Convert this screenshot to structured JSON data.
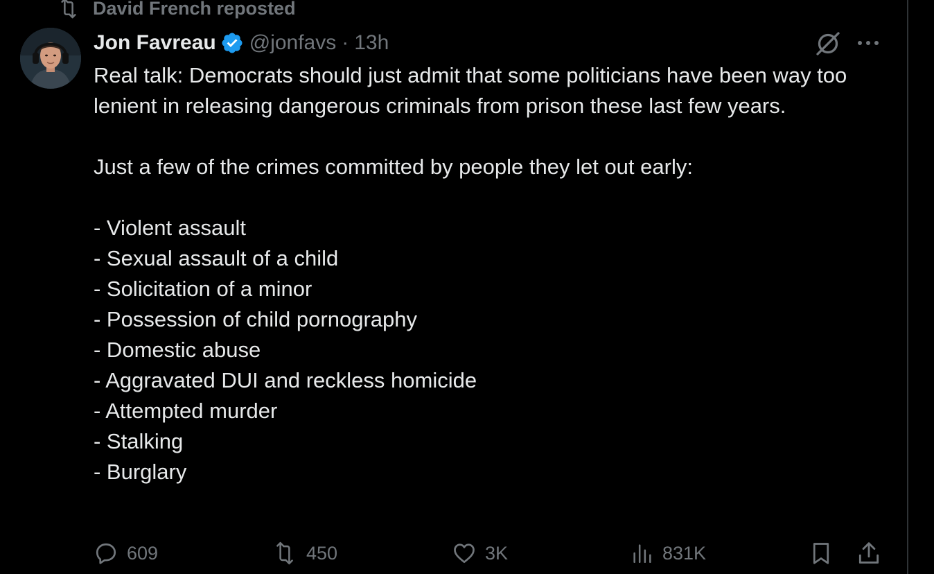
{
  "repost_banner": {
    "text": "David French reposted"
  },
  "tweet": {
    "author": {
      "display_name": "Jon Favreau",
      "handle": "@jonfavs",
      "verified": true
    },
    "separator": "·",
    "time": "13h",
    "lines": [
      "Real talk: Democrats should just admit that some politicians have been way too lenient in releasing dangerous criminals from prison these last few years.",
      "",
      "Just a few of the crimes committed by people they let out early:",
      "",
      "- Violent assault",
      "- Sexual assault of a child",
      "- Solicitation of a minor",
      "- Possession of child pornography",
      "- Domestic abuse",
      "- Aggravated DUI and reckless homicide",
      "- Attempted murder",
      "- Stalking",
      "- Burglary"
    ]
  },
  "actions": {
    "replies": "609",
    "reposts": "450",
    "likes": "3K",
    "views": "831K"
  },
  "icons": {
    "repost": "repost-icon",
    "verified": "verified-badge-icon",
    "grok": "grok-icon",
    "more": "more-icon",
    "reply": "reply-icon",
    "like": "heart-icon",
    "views": "views-icon",
    "bookmark": "bookmark-icon",
    "share": "share-icon"
  },
  "colors": {
    "background": "#000000",
    "text": "#e7e9ea",
    "muted": "#71767b",
    "verified": "#1d9bf0"
  }
}
